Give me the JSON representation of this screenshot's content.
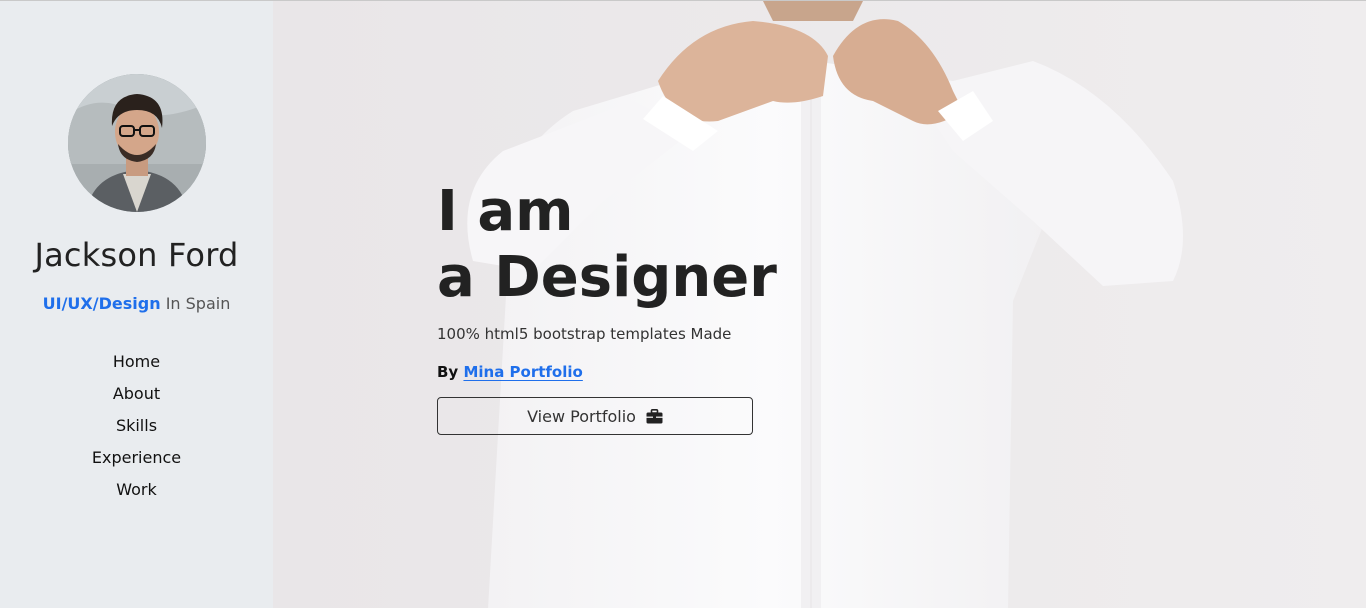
{
  "profile": {
    "name": "Jackson Ford",
    "role": "UI/UX/Design",
    "location": "In Spain"
  },
  "nav": {
    "items": [
      {
        "label": "Home"
      },
      {
        "label": "About"
      },
      {
        "label": "Skills"
      },
      {
        "label": "Experience"
      },
      {
        "label": "Work"
      }
    ]
  },
  "hero": {
    "headline_line1": "I am",
    "headline_line2": "a Designer",
    "subtitle": "100% html5 bootstrap templates Made",
    "by_label": "By",
    "by_link": "Mina Portfolio",
    "button_label": "View Portfolio",
    "button_icon": "briefcase-icon"
  },
  "colors": {
    "accent": "#1f6feb",
    "sidebar_bg": "#e9ecef",
    "hero_bg": "#ebe8ea",
    "text": "#222222"
  }
}
